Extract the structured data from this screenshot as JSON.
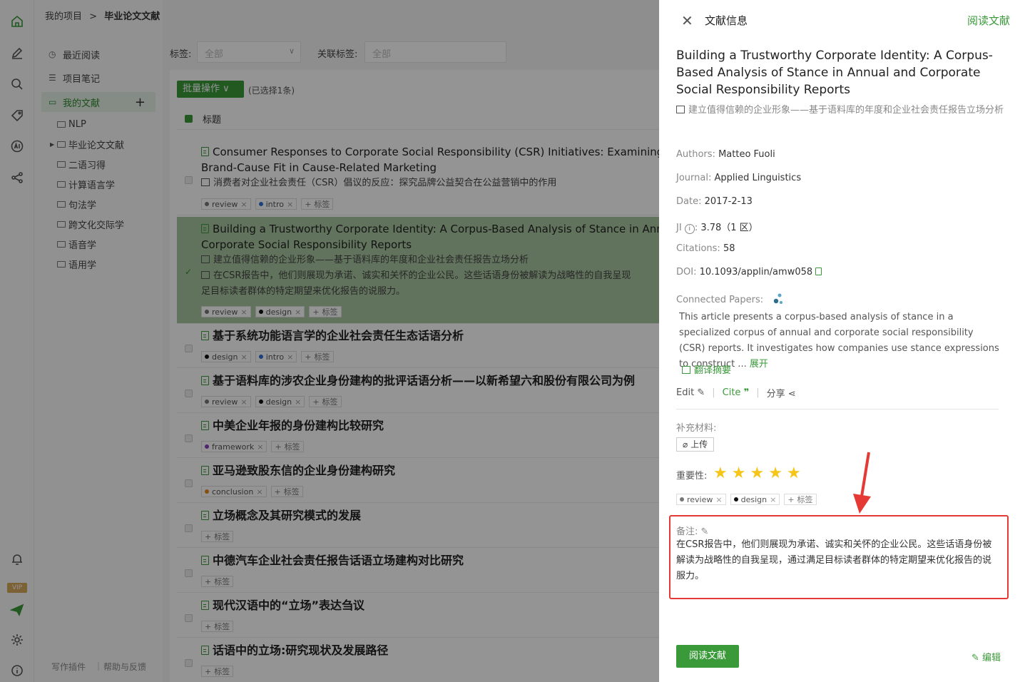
{
  "breadcrumb": {
    "project": "我的项目",
    "separator": ">",
    "current": "毕业论文文献"
  },
  "sidebar": {
    "nav": [
      {
        "label": "最近阅读",
        "icon": "clock-icon"
      },
      {
        "label": "项目笔记",
        "icon": "list-icon"
      },
      {
        "label": "我的文献",
        "icon": "folder-icon",
        "active": true
      }
    ],
    "folders": [
      "NLP",
      "毕业论文文献",
      "二语习得",
      "计算语言学",
      "句法学",
      "跨文化交际学",
      "语音学",
      "语用学"
    ],
    "footer": {
      "plugin": "写作插件",
      "help": "帮助与反馈"
    }
  },
  "rail": {
    "vip_label": "VIP"
  },
  "filters": {
    "tag_label": "标签:",
    "tag_value": "全部",
    "rel_label": "关联标签:",
    "rel_value": "全部"
  },
  "toolbar": {
    "batch_label": "批量操作",
    "selected_info": "(已选择1条)",
    "column_title": "标题"
  },
  "list": [
    {
      "title": "Consumer Responses to Corporate Social Responsibility (CSR) Initiatives: Examining the Role of Brand-Cause Fit in Cause-Related Marketing",
      "title_shown_line1": "Consumer Responses to Corporate Social Responsibility (CSR) Initiatives: Examining th",
      "title_shown_line2": "Brand-Cause Fit in Cause-Related Marketing",
      "translation": "消费者对企业社会责任（CSR）倡议的反应：探究品牌公益契合在公益营销中的作用",
      "tags": [
        {
          "name": "review",
          "color": "#777"
        },
        {
          "name": "intro",
          "color": "#2f6fd6"
        }
      ]
    },
    {
      "title_shown_line1": "Building a Trustworthy Corporate Identity: A Corpus-Based Analysis of Stance in Annu",
      "title_shown_line2": "Corporate Social Responsibility Reports",
      "translation": "建立值得信赖的企业形象——基于语料库的年度和企业社会责任报告立场分析",
      "note": "在CSR报告中，他们则展现为承诺、诚实和关怀的企业公民。这些话语身份被解读为战略性的自我呈现",
      "note_line2": "足目标读者群体的特定期望来优化报告的说服力。",
      "tags": [
        {
          "name": "review",
          "color": "#777"
        },
        {
          "name": "design",
          "color": "#111"
        }
      ],
      "selected": true
    },
    {
      "title_shown_line1": "基于系统功能语言学的企业社会责任生态话语分析",
      "tags": [
        {
          "name": "design",
          "color": "#111"
        },
        {
          "name": "intro",
          "color": "#2f6fd6"
        }
      ]
    },
    {
      "title_shown_line1": "基于语料库的涉农企业身份建构的批评话语分析——以新希望六和股份有限公司为例",
      "tags": [
        {
          "name": "review",
          "color": "#777"
        },
        {
          "name": "design",
          "color": "#111"
        }
      ]
    },
    {
      "title_shown_line1": "中美企业年报的身份建构比较研究",
      "tags": [
        {
          "name": "framework",
          "color": "#8a3fbf"
        }
      ]
    },
    {
      "title_shown_line1": "亚马逊致股东信的企业身份建构研究",
      "tags": [
        {
          "name": "conclusion",
          "color": "#e88a1a"
        }
      ]
    },
    {
      "title_shown_line1": "立场概念及其研究模式的发展",
      "tags": []
    },
    {
      "title_shown_line1": "中德汽车企业社会责任报告话语立场建构对比研究",
      "tags": []
    },
    {
      "title_shown_line1": "现代汉语中的“立场”表达刍议",
      "tags": []
    },
    {
      "title_shown_line1": "话语中的立场:研究现状及发展路径",
      "tags": []
    }
  ],
  "add_tag_label": "标签",
  "panel": {
    "header_title": "文献信息",
    "read_link": "阅读文献",
    "paper_title": "Building a Trustworthy Corporate Identity: A Corpus-Based Analysis of Stance in Annual and Corporate Social Responsibility Reports",
    "paper_title_cn": "建立值得信赖的企业形象——基于语料库的年度和企业社会责任报告立场分析",
    "authors_label": "Authors:",
    "authors": "Matteo Fuoli",
    "journal_label": "Journal:",
    "journal": "Applied Linguistics",
    "date_label": "Date:",
    "date": "2017-2-13",
    "ji_label": "JI",
    "ji_value": "3.78（1 区）",
    "citations_label": "Citations:",
    "citations": "58",
    "doi_label": "DOI:",
    "doi": "10.1093/applin/amw058",
    "connected_label": "Connected Papers:",
    "abstract": "This article presents a corpus-based analysis of stance in a specialized corpus of annual and corporate social responsibility (CSR) reports. It investigates how companies use stance expressions to construct ...",
    "abstract_more": "展开",
    "translate_label": "翻译摘要",
    "edit_label": "Edit",
    "cite_label": "Cite",
    "share_label": "分享",
    "supplement_label": "补充材料:",
    "upload_label": "上传",
    "importance_label": "重要性:",
    "importance_value": 5,
    "importance_max": 5,
    "tags": [
      {
        "name": "review",
        "color": "#777"
      },
      {
        "name": "design",
        "color": "#111"
      }
    ],
    "note_label": "备注:",
    "note_text": "在CSR报告中，他们则展现为承诺、诚实和关怀的企业公民。这些话语身份被解读为战略性的自我呈现，通过满足目标读者群体的特定期望来优化报告的说服力。",
    "read_button": "阅读文献",
    "edit_button": "编辑"
  },
  "colors": {
    "accent": "#3a9a3a",
    "highlight_box": "#e53935",
    "star": "#f5c518"
  }
}
